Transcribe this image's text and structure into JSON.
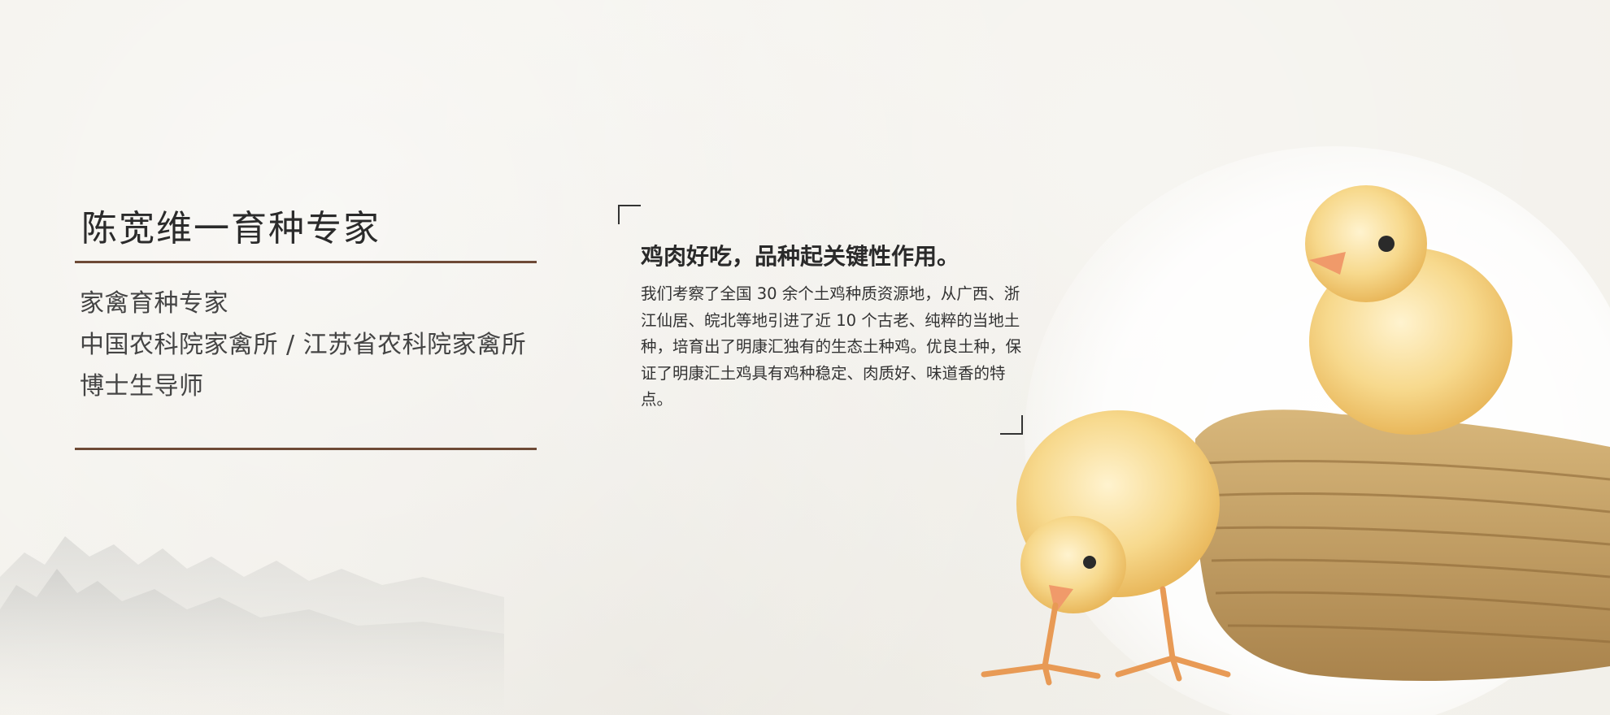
{
  "profile": {
    "title": "陈宽维一育种专家",
    "lines": [
      "家禽育种专家",
      "中国农科院家禽所 / 江苏省农科院家禽所",
      "博士生导师"
    ]
  },
  "quote": {
    "heading": "鸡肉好吃，品种起关键性作用。",
    "body": "我们考察了全国 30 余个土鸡种质资源地，从广西、浙江仙居、皖北等地引进了近 10 个古老、纯粹的当地土种，培育出了明康汇独有的生态土种鸡。优良土种，保证了明康汇土鸡具有鸡种稳定、肉质好、味道香的特点。"
  },
  "colors": {
    "background": "#f2f0ea",
    "rule": "#6e4a36",
    "chick": "#f6d48a",
    "nest": "#c9a56a"
  }
}
